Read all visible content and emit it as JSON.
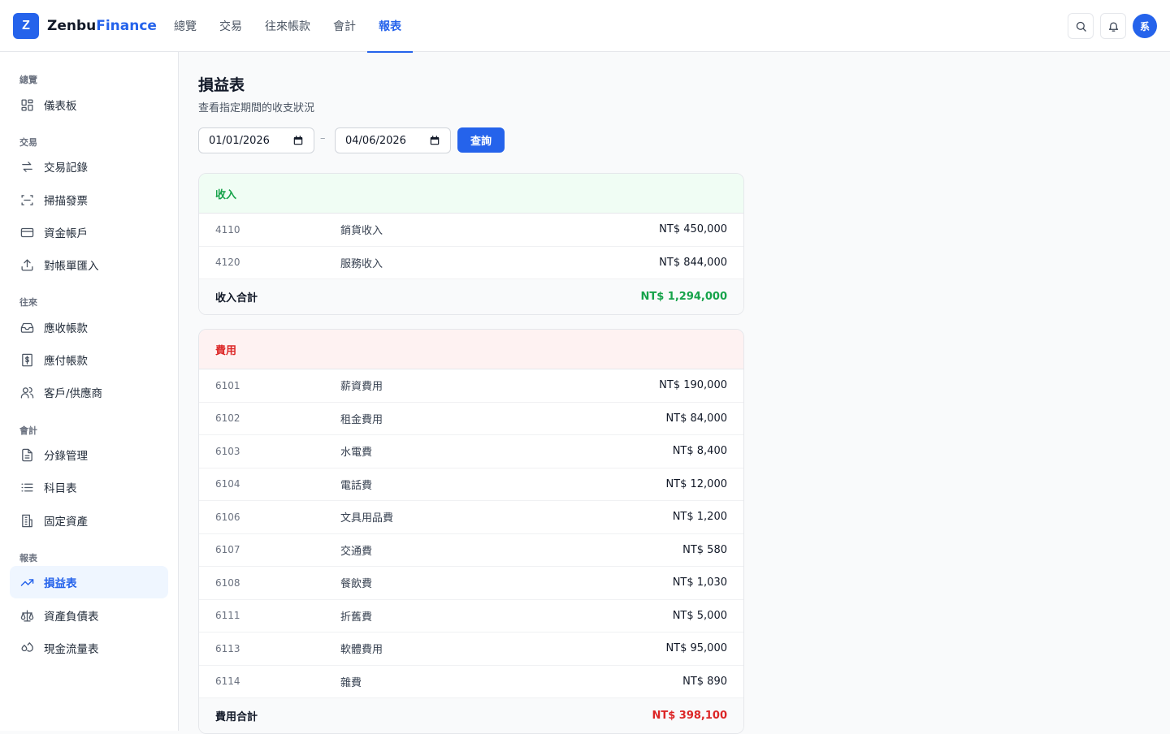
{
  "app": {
    "logo_letter": "Z",
    "brand_part1": "Zenbu",
    "brand_part2": "Finance"
  },
  "topnav": {
    "items": [
      "總覽",
      "交易",
      "往來帳款",
      "會計",
      "報表"
    ],
    "active": "報表"
  },
  "user": {
    "avatar_initial": "系"
  },
  "sidebar": {
    "sections": [
      {
        "label": "總覽",
        "items": [
          {
            "label": "儀表板",
            "icon": "dashboard-icon"
          }
        ]
      },
      {
        "label": "交易",
        "items": [
          {
            "label": "交易記錄",
            "icon": "transfer-arrows-icon"
          },
          {
            "label": "掃描發票",
            "icon": "scan-icon"
          },
          {
            "label": "資金帳戶",
            "icon": "credit-card-icon"
          },
          {
            "label": "對帳單匯入",
            "icon": "upload-icon"
          }
        ]
      },
      {
        "label": "往來",
        "items": [
          {
            "label": "應收帳款",
            "icon": "inbox-icon"
          },
          {
            "label": "應付帳款",
            "icon": "dollar-receipt-icon"
          },
          {
            "label": "客戶/供應商",
            "icon": "users-icon"
          }
        ]
      },
      {
        "label": "會計",
        "items": [
          {
            "label": "分錄管理",
            "icon": "document-icon"
          },
          {
            "label": "科目表",
            "icon": "list-icon"
          },
          {
            "label": "固定資產",
            "icon": "building-icon"
          }
        ]
      },
      {
        "label": "報表",
        "items": [
          {
            "label": "損益表",
            "icon": "trending-up-icon",
            "active": true
          },
          {
            "label": "資產負債表",
            "icon": "scale-icon"
          },
          {
            "label": "現金流量表",
            "icon": "droplets-icon"
          }
        ]
      }
    ]
  },
  "page": {
    "title": "損益表",
    "subtitle": "查看指定期間的收支狀況",
    "date_from": "01/01/2026",
    "date_separator": "–",
    "date_to": "04/06/2026",
    "query_label": "查詢"
  },
  "income": {
    "header": "收入",
    "rows": [
      {
        "code": "4110",
        "name": "銷貨收入",
        "amount": "NT$ 450,000"
      },
      {
        "code": "4120",
        "name": "服務收入",
        "amount": "NT$ 844,000"
      }
    ],
    "total_label": "收入合計",
    "total_amount": "NT$ 1,294,000",
    "color": "#16a34a"
  },
  "expense": {
    "header": "費用",
    "rows": [
      {
        "code": "6101",
        "name": "薪資費用",
        "amount": "NT$ 190,000"
      },
      {
        "code": "6102",
        "name": "租金費用",
        "amount": "NT$ 84,000"
      },
      {
        "code": "6103",
        "name": "水電費",
        "amount": "NT$ 8,400"
      },
      {
        "code": "6104",
        "name": "電話費",
        "amount": "NT$ 12,000"
      },
      {
        "code": "6106",
        "name": "文具用品費",
        "amount": "NT$ 1,200"
      },
      {
        "code": "6107",
        "name": "交通費",
        "amount": "NT$ 580"
      },
      {
        "code": "6108",
        "name": "餐飲費",
        "amount": "NT$ 1,030"
      },
      {
        "code": "6111",
        "name": "折舊費",
        "amount": "NT$ 5,000"
      },
      {
        "code": "6113",
        "name": "軟體費用",
        "amount": "NT$ 95,000"
      },
      {
        "code": "6114",
        "name": "雜費",
        "amount": "NT$ 890"
      }
    ],
    "total_label": "費用合計",
    "total_amount": "NT$ 398,100",
    "color": "#dc2626"
  },
  "colors": {
    "accent": "#2563eb",
    "income_header_bg": "#f0fdf4",
    "expense_header_bg": "#fef2f2"
  }
}
